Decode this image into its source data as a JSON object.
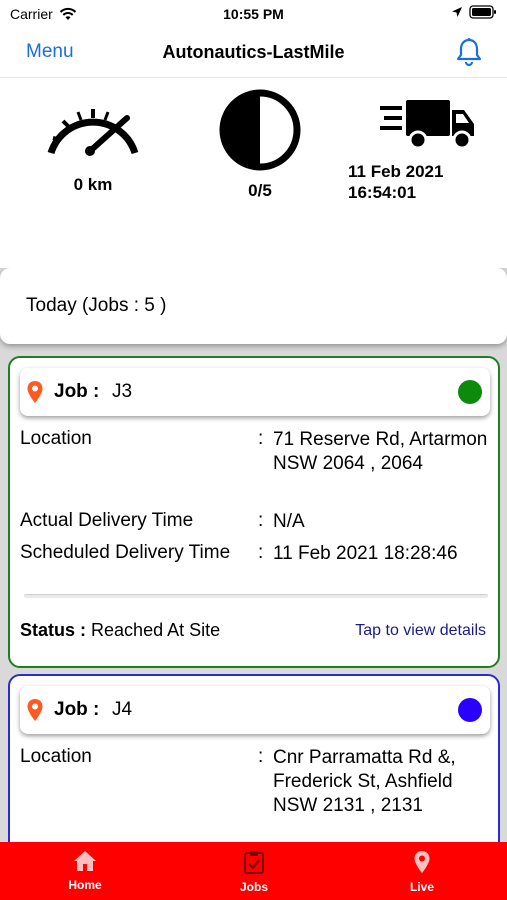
{
  "status_bar": {
    "carrier": "Carrier",
    "time": "10:55 PM"
  },
  "nav": {
    "menu_label": "Menu",
    "title": "Autonautics-LastMile"
  },
  "summary": {
    "distance": "0 km",
    "jobs_progress": "0/5",
    "last_update_date": "11 Feb 2021",
    "last_update_time": "16:54:01"
  },
  "today": {
    "label": "Today (Jobs : 5 )"
  },
  "jobs": [
    {
      "job_label": "Job :",
      "job_id": "J3",
      "status_color": "#0b8a0b",
      "location_label": "Location",
      "location_value": "71 Reserve Rd, Artarmon NSW 2064 , 2064",
      "actual_label": "Actual Delivery Time",
      "actual_value": "N/A",
      "scheduled_label": "Scheduled Delivery Time",
      "scheduled_value": "11 Feb 2021 18:28:46",
      "status_label": "Status :",
      "status_value": "Reached At Site",
      "details_link": "Tap to view details"
    },
    {
      "job_label": "Job :",
      "job_id": "J4",
      "status_color": "#2a00ff",
      "location_label": "Location",
      "location_value": "Cnr Parramatta Rd &, Frederick St, Ashfield NSW 2131 , 2131"
    }
  ],
  "colon": ":",
  "tabs": [
    {
      "label": "Home",
      "icon": "home-icon"
    },
    {
      "label": "Jobs",
      "icon": "clipboard-icon"
    },
    {
      "label": "Live",
      "icon": "location-pin-icon"
    }
  ],
  "colors": {
    "accent": "#1a6fe0",
    "tab_bar": "#ff0000",
    "pin": "#ff5a1f"
  }
}
